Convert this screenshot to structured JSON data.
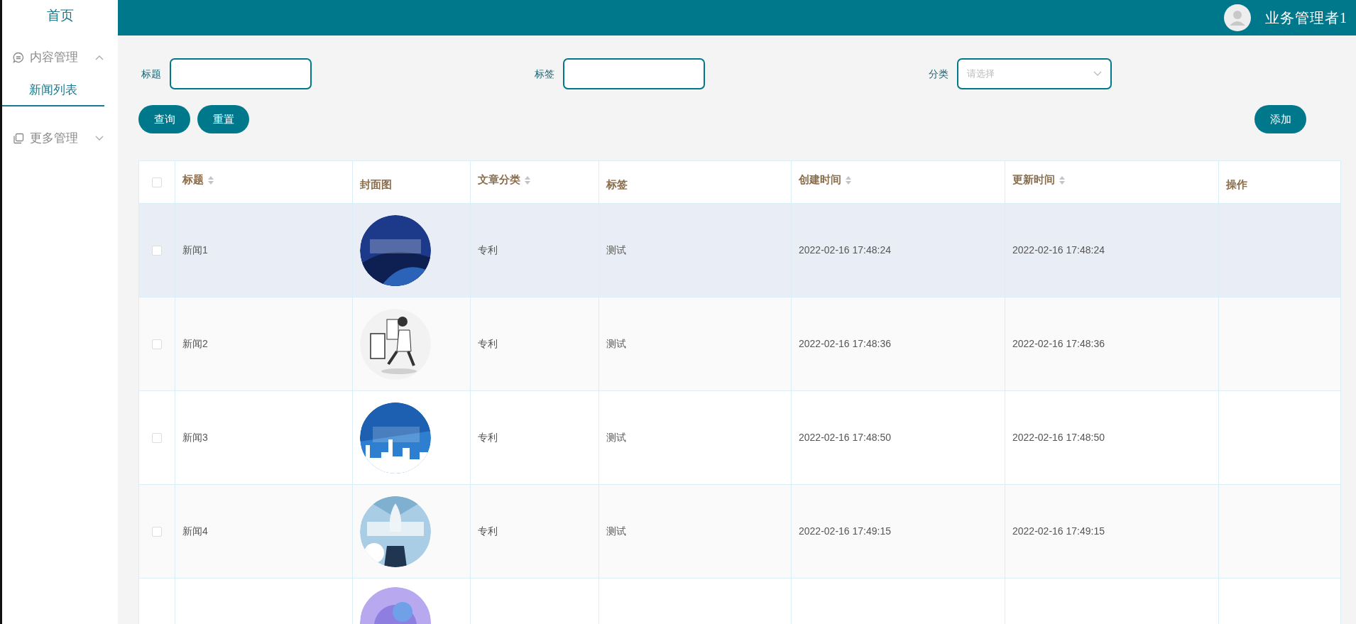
{
  "sidebar": {
    "home": "首页",
    "menus": [
      {
        "label": "内容管理",
        "expanded": true,
        "children": [
          {
            "label": "新闻列表",
            "selected": true
          }
        ]
      },
      {
        "label": "更多管理",
        "expanded": false
      }
    ]
  },
  "header": {
    "user": "业务管理者1"
  },
  "filters": [
    {
      "kind": "input",
      "label": "标题"
    },
    {
      "kind": "input",
      "label": "标签"
    },
    {
      "kind": "select",
      "label": "分类",
      "placeholder": "请选择"
    }
  ],
  "actions": [
    "查询",
    "重置"
  ],
  "add_button": "添加",
  "table": {
    "select_all": {
      "checked": false
    },
    "columns": [
      {
        "label": "标题",
        "sortable": true
      },
      {
        "label": "封面图",
        "sortable": false
      },
      {
        "label": "文章分类",
        "sortable": true
      },
      {
        "label": "标签",
        "sortable": false
      },
      {
        "label": "创建时间",
        "sortable": true
      },
      {
        "label": "更新时间",
        "sortable": true
      },
      {
        "label": "操作",
        "sortable": false
      }
    ],
    "rows": [
      {
        "checked": false,
        "hovered": true,
        "title": "新闻1",
        "cover": {
          "kind": "picture"
        },
        "category": "专利",
        "tag": "测试",
        "created": "2022-02-16 17:48:24",
        "updated": "2022-02-16 17:48:24"
      },
      {
        "checked": false,
        "hovered": false,
        "title": "新闻2",
        "cover": {
          "kind": "picture"
        },
        "category": "专利",
        "tag": "测试",
        "created": "2022-02-16 17:48:36",
        "updated": "2022-02-16 17:48:36"
      },
      {
        "checked": false,
        "hovered": false,
        "title": "新闻3",
        "cover": {
          "kind": "picture"
        },
        "category": "专利",
        "tag": "测试",
        "created": "2022-02-16 17:48:50",
        "updated": "2022-02-16 17:48:50"
      },
      {
        "checked": false,
        "hovered": false,
        "title": "新闻4",
        "cover": {
          "kind": "picture"
        },
        "category": "专利",
        "tag": "测试",
        "created": "2022-02-16 17:49:15",
        "updated": "2022-02-16 17:49:15"
      },
      {
        "cover": {
          "kind": "picture"
        }
      }
    ]
  }
}
